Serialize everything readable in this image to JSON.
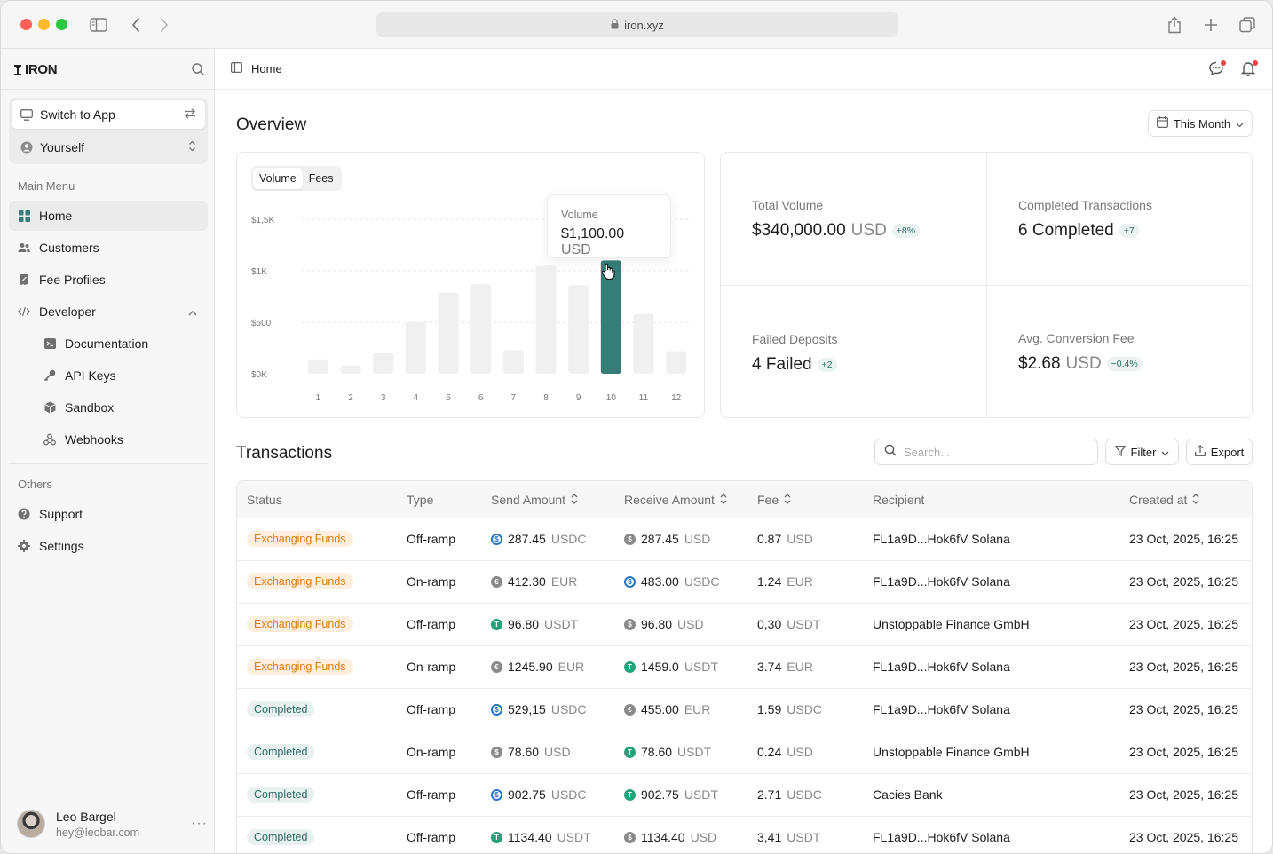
{
  "browser": {
    "url": "iron.xyz"
  },
  "sidebar": {
    "brand": "IRON",
    "switch_label": "Switch to App",
    "account": "Yourself",
    "main_menu_label": "Main Menu",
    "items": [
      "Home",
      "Customers",
      "Fee Profiles",
      "Developer"
    ],
    "dev_items": [
      "Documentation",
      "API Keys",
      "Sandbox",
      "Webhooks"
    ],
    "others_label": "Others",
    "other_items": [
      "Support",
      "Settings"
    ],
    "user": {
      "name": "Leo Bargel",
      "email": "hey@leobar.com"
    }
  },
  "topbar": {
    "breadcrumb": "Home"
  },
  "overview": {
    "title": "Overview",
    "period": "This Month",
    "tabs": [
      "Volume",
      "Fees"
    ],
    "tooltip": {
      "label": "Volume",
      "amount": "$1,100.00",
      "unit": "USD"
    },
    "stats": [
      {
        "label": "Total Volume",
        "value": "$340,000.00",
        "unit": "USD",
        "delta": "+8%"
      },
      {
        "label": "Completed Transactions",
        "value": "6 Completed",
        "unit": "",
        "delta": "+7"
      },
      {
        "label": "Failed Deposits",
        "value": "4 Failed",
        "unit": "",
        "delta": "+2"
      },
      {
        "label": "Avg. Conversion Fee",
        "value": "$2.68",
        "unit": "USD",
        "delta": "−0.4%"
      }
    ]
  },
  "chart_data": {
    "type": "bar",
    "categories": [
      "1",
      "2",
      "3",
      "4",
      "5",
      "6",
      "7",
      "8",
      "9",
      "10",
      "11",
      "12"
    ],
    "values": [
      140,
      80,
      200,
      500,
      790,
      870,
      230,
      1050,
      860,
      1100,
      580,
      220
    ],
    "highlight_index": 9,
    "ytick_labels": [
      "$0K",
      "$500",
      "$1K",
      "$1,5K"
    ],
    "yticks": [
      0,
      500,
      1000,
      1500
    ],
    "ylim": [
      0,
      1500
    ],
    "colors": {
      "bar": "#f0f0f0",
      "highlight": "#367d78"
    }
  },
  "transactions": {
    "title": "Transactions",
    "search_placeholder": "Search...",
    "filter_label": "Filter",
    "export_label": "Export",
    "columns": [
      "Status",
      "Type",
      "Send Amount",
      "Receive Amount",
      "Fee",
      "Recipient",
      "Created at"
    ],
    "rows": [
      {
        "status": "Exchanging Funds",
        "type": "Off-ramp",
        "send": "287.45",
        "send_cur": "USDC",
        "recv": "287.45",
        "recv_cur": "USD",
        "fee": "0.87",
        "fee_cur": "USD",
        "recipient": "FL1a9D...Hok6fV Solana",
        "created": "23 Oct, 2025, 16:25"
      },
      {
        "status": "Exchanging Funds",
        "type": "On-ramp",
        "send": "412.30",
        "send_cur": "EUR",
        "recv": "483.00",
        "recv_cur": "USDC",
        "fee": "1.24",
        "fee_cur": "EUR",
        "recipient": "FL1a9D...Hok6fV Solana",
        "created": "23 Oct, 2025, 16:25"
      },
      {
        "status": "Exchanging Funds",
        "type": "Off-ramp",
        "send": "96.80",
        "send_cur": "USDT",
        "recv": "96.80",
        "recv_cur": "USD",
        "fee": "0,30",
        "fee_cur": "USDT",
        "recipient": "Unstoppable Finance GmbH",
        "created": "23 Oct, 2025, 16:25"
      },
      {
        "status": "Exchanging Funds",
        "type": "On-ramp",
        "send": "1245.90",
        "send_cur": "EUR",
        "recv": "1459.0",
        "recv_cur": "USDT",
        "fee": "3.74",
        "fee_cur": "EUR",
        "recipient": "FL1a9D...Hok6fV Solana",
        "created": "23 Oct, 2025, 16:25"
      },
      {
        "status": "Completed",
        "type": "Off-ramp",
        "send": "529,15",
        "send_cur": "USDC",
        "recv": "455.00",
        "recv_cur": "EUR",
        "fee": "1.59",
        "fee_cur": "USDC",
        "recipient": "FL1a9D...Hok6fV Solana",
        "created": "23 Oct, 2025, 16:25"
      },
      {
        "status": "Completed",
        "type": "On-ramp",
        "send": "78.60",
        "send_cur": "USD",
        "recv": "78.60",
        "recv_cur": "USDT",
        "fee": "0.24",
        "fee_cur": "USD",
        "recipient": "Unstoppable Finance GmbH",
        "created": "23 Oct, 2025, 16:25"
      },
      {
        "status": "Completed",
        "type": "Off-ramp",
        "send": "902.75",
        "send_cur": "USDC",
        "recv": "902.75",
        "recv_cur": "USDT",
        "fee": "2.71",
        "fee_cur": "USDC",
        "recipient": "Cacies Bank",
        "created": "23 Oct, 2025, 16:25"
      },
      {
        "status": "Completed",
        "type": "Off-ramp",
        "send": "1134.40",
        "send_cur": "USDT",
        "recv": "1134.40",
        "recv_cur": "USD",
        "fee": "3,41",
        "fee_cur": "USDT",
        "recipient": "FL1a9D...Hok6fV Solana",
        "created": "23 Oct, 2025, 16:25"
      }
    ]
  }
}
